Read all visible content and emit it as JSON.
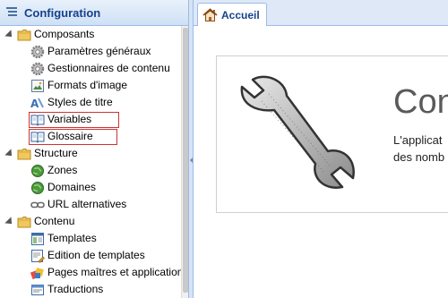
{
  "sidebar": {
    "title": "Configuration",
    "groups": [
      {
        "label": "Composants",
        "items": [
          {
            "label": "Paramètres généraux",
            "icon": "gear-icon"
          },
          {
            "label": "Gestionnaires de contenu",
            "icon": "gear-icon"
          },
          {
            "label": "Formats d'image",
            "icon": "image-icon"
          },
          {
            "label": "Styles de titre",
            "icon": "title-style-icon"
          },
          {
            "label": "Variables",
            "icon": "book-icon",
            "highlighted": true
          },
          {
            "label": "Glossaire",
            "icon": "book-icon",
            "highlighted": true
          }
        ]
      },
      {
        "label": "Structure",
        "items": [
          {
            "label": "Zones",
            "icon": "globe-icon"
          },
          {
            "label": "Domaines",
            "icon": "globe-icon"
          },
          {
            "label": "URL alternatives",
            "icon": "link-icon"
          }
        ]
      },
      {
        "label": "Contenu",
        "items": [
          {
            "label": "Templates",
            "icon": "template-icon"
          },
          {
            "label": "Edition de templates",
            "icon": "edit-template-icon"
          },
          {
            "label": "Pages maîtres et applications",
            "icon": "master-pages-icon"
          },
          {
            "label": "Traductions",
            "icon": "translations-icon"
          }
        ]
      }
    ]
  },
  "tabs": [
    {
      "label": "Accueil",
      "icon": "home-icon"
    }
  ],
  "main": {
    "title": "Con",
    "description_lines": [
      "L'applicat",
      "des nomb"
    ]
  },
  "colors": {
    "accent": "#15428b",
    "highlight": "#cc3333",
    "border": "#99bbe8"
  }
}
